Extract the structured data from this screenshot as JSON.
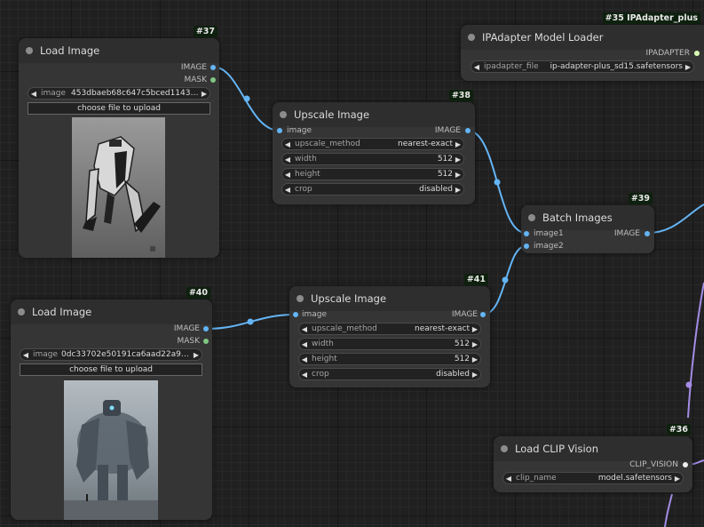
{
  "nodes": {
    "load37": {
      "id": "#37",
      "title": "Load Image",
      "outputs": [
        "IMAGE",
        "MASK"
      ],
      "widget": {
        "name": "image",
        "value": "453dbaeb68c647c5bced114323c..."
      },
      "upload_label": "choose file to upload",
      "preview_icon": "robot-mech-preview"
    },
    "load40": {
      "id": "#40",
      "title": "Load Image",
      "outputs": [
        "IMAGE",
        "MASK"
      ],
      "widget": {
        "name": "image",
        "value": "0dc33702e50191ca6aad22a9979..."
      },
      "upload_label": "choose file to upload",
      "preview_icon": "giant-robot-preview"
    },
    "upscale38": {
      "id": "#38",
      "title": "Upscale Image",
      "input": "image",
      "output": "IMAGE",
      "widgets": [
        {
          "name": "upscale_method",
          "value": "nearest-exact"
        },
        {
          "name": "width",
          "value": "512"
        },
        {
          "name": "height",
          "value": "512"
        },
        {
          "name": "crop",
          "value": "disabled"
        }
      ]
    },
    "upscale41": {
      "id": "#41",
      "title": "Upscale Image",
      "input": "image",
      "output": "IMAGE",
      "widgets": [
        {
          "name": "upscale_method",
          "value": "nearest-exact"
        },
        {
          "name": "width",
          "value": "512"
        },
        {
          "name": "height",
          "value": "512"
        },
        {
          "name": "crop",
          "value": "disabled"
        }
      ]
    },
    "ipadapter35": {
      "id": "#35 IPAdapter_plus",
      "title": "IPAdapter Model Loader",
      "output": "IPADAPTER",
      "widget": {
        "name": "ipadapter_file",
        "value": "ip-adapter-plus_sd15.safetensors"
      }
    },
    "batch39": {
      "id": "#39",
      "title": "Batch Images",
      "inputs": [
        "image1",
        "image2"
      ],
      "output": "IMAGE"
    },
    "clip36": {
      "id": "#36",
      "title": "Load CLIP Vision",
      "output": "CLIP_VISION",
      "widget": {
        "name": "clip_name",
        "value": "model.safetensors"
      }
    }
  },
  "colors": {
    "image_link": "#64b5f6",
    "mask_port": "#81c784",
    "clip_vision_link": "#a48ce6",
    "ipadapter_port": "#d9ffb3",
    "node_body": "#353535",
    "node_header": "#2e2e2e",
    "canvas": "#202020"
  },
  "icons": {
    "collapse": "collapse-dot-icon",
    "arrow_left": "arrow-left-icon",
    "arrow_right": "arrow-right-icon"
  }
}
